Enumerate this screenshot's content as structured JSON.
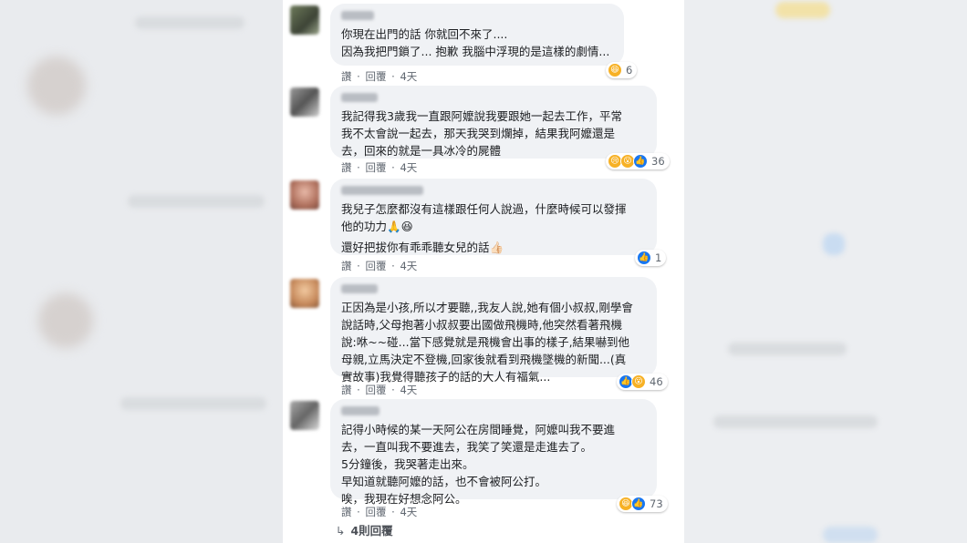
{
  "comments": [
    {
      "lines": [
        "你現在出門的話 你就回不來了....",
        "因為我把門鎖了... 抱歉 我腦中浮現的是這樣的劇情..."
      ],
      "actions": {
        "like": "讚",
        "reply": "回覆",
        "time": "4天"
      },
      "reactions": {
        "icons": [
          "haha-icon"
        ],
        "count": "6"
      }
    },
    {
      "lines": [
        "我記得我3歲我一直跟阿嬤說我要跟她一起去工作，平常",
        "我不太會說一起去，那天我哭到爛掉，結果我阿嬤還是",
        "去，回來的就是一具冰冷的屍體"
      ],
      "actions": {
        "like": "讚",
        "reply": "回覆",
        "time": "4天"
      },
      "reactions": {
        "icons": [
          "sad-icon",
          "wow-icon",
          "like-icon"
        ],
        "count": "36"
      }
    },
    {
      "lines": [
        "我兒子怎麼都沒有這樣跟任何人說過，什麼時候可以發揮",
        "他的功力🙏😆",
        "還好把拔你有乖乖聽女兒的話👍🏻"
      ],
      "actions": {
        "like": "讚",
        "reply": "回覆",
        "time": "4天"
      },
      "reactions": {
        "icons": [
          "like-icon"
        ],
        "count": "1"
      }
    },
    {
      "lines": [
        "正因為是小孩,所以才要聽,,我友人說,她有個小叔叔,剛學會",
        "說話時,父母抱著小叔叔要出國做飛機時,他突然看著飛機",
        "說:咻~~碰...當下感覺就是飛機會出事的樣子,結果嚇到他",
        "母親,立馬決定不登機,回家後就看到飛機墜機的新聞...(真",
        "實故事)我覺得聽孩子的話的大人有福氣..."
      ],
      "actions": {
        "like": "讚",
        "reply": "回覆",
        "time": "4天"
      },
      "reactions": {
        "icons": [
          "like-icon",
          "wow-icon"
        ],
        "count": "46"
      }
    },
    {
      "lines": [
        "記得小時候的某一天阿公在房間睡覺，阿嬤叫我不要進",
        "去，一直叫我不要進去，我笑了笑還是走進去了。",
        "5分鐘後，我哭著走出來。",
        "早知道就聽阿嬤的話，也不會被阿公打。",
        "唉，我現在好想念阿公。"
      ],
      "actions": {
        "like": "讚",
        "reply": "回覆",
        "time": "4天"
      },
      "reactions": {
        "icons": [
          "haha-icon",
          "like-icon"
        ],
        "count": "73"
      }
    }
  ],
  "more_replies": {
    "arrow": "↳",
    "label": "4則回覆"
  }
}
